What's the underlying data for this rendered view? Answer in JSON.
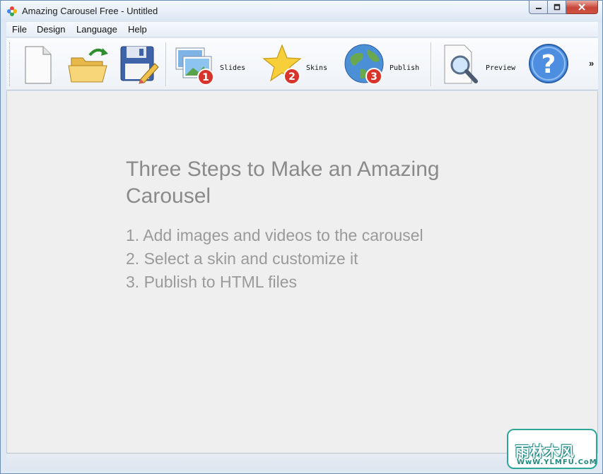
{
  "window": {
    "title": "Amazing Carousel Free - Untitled",
    "app_icon": "carousel-logo-icon"
  },
  "menu": {
    "items": [
      "File",
      "Design",
      "Language",
      "Help"
    ]
  },
  "toolbar": {
    "new_icon": "new-file-icon",
    "open_icon": "open-folder-icon",
    "save_icon": "save-floppy-icon",
    "slides_label": "Slides",
    "slides_step": "1",
    "skins_label": "Skins",
    "skins_step": "2",
    "publish_label": "Publish",
    "publish_step": "3",
    "preview_label": "Preview",
    "help_icon": "help-question-icon",
    "overflow": "»"
  },
  "main": {
    "heading": "Three Steps to Make an Amazing Carousel",
    "steps": [
      "1. Add images and videos to the carousel",
      "2. Select a skin and customize it",
      "3. Publish to HTML files"
    ]
  },
  "watermark": {
    "top": "雨林木风",
    "bottom": "WwW.YLMFU.CoM"
  },
  "colors": {
    "badge_red": "#d9342b",
    "heading_gray": "#8a8a8a",
    "content_bg": "#efefef",
    "watermark_teal": "#2ea79b"
  }
}
